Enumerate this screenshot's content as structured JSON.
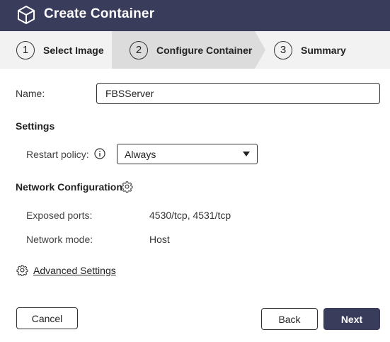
{
  "window": {
    "title": "Create Container",
    "title_icon": "cube-icon"
  },
  "wizard": {
    "steps": [
      {
        "number": "1",
        "label": "Select Image",
        "state": "completed"
      },
      {
        "number": "2",
        "label": "Configure Container",
        "state": "active"
      },
      {
        "number": "3",
        "label": "Summary",
        "state": "pending"
      }
    ],
    "active_step_color": "#dcdcdc",
    "inactive_step_color": "#f2f2f2"
  },
  "form": {
    "name_label": "Name:",
    "name_value": "FBSServer",
    "settings_heading": "Settings",
    "restart_policy_label": "Restart policy:",
    "restart_policy_info_icon": "info-icon",
    "restart_policy_value": "Always",
    "network_heading": "Network Configuration",
    "network_gear_icon": "gear-icon",
    "exposed_ports_label": "Exposed ports:",
    "exposed_ports_value": "4530/tcp, 4531/tcp",
    "network_mode_label": "Network mode:",
    "network_mode_value": "Host",
    "advanced_settings_label": "Advanced Settings",
    "advanced_settings_icon": "gear-icon"
  },
  "footer": {
    "cancel_label": "Cancel",
    "back_label": "Back",
    "next_label": "Next"
  },
  "colors": {
    "header_bg": "#3a3c5c",
    "primary_button": "#3a3c5c"
  }
}
